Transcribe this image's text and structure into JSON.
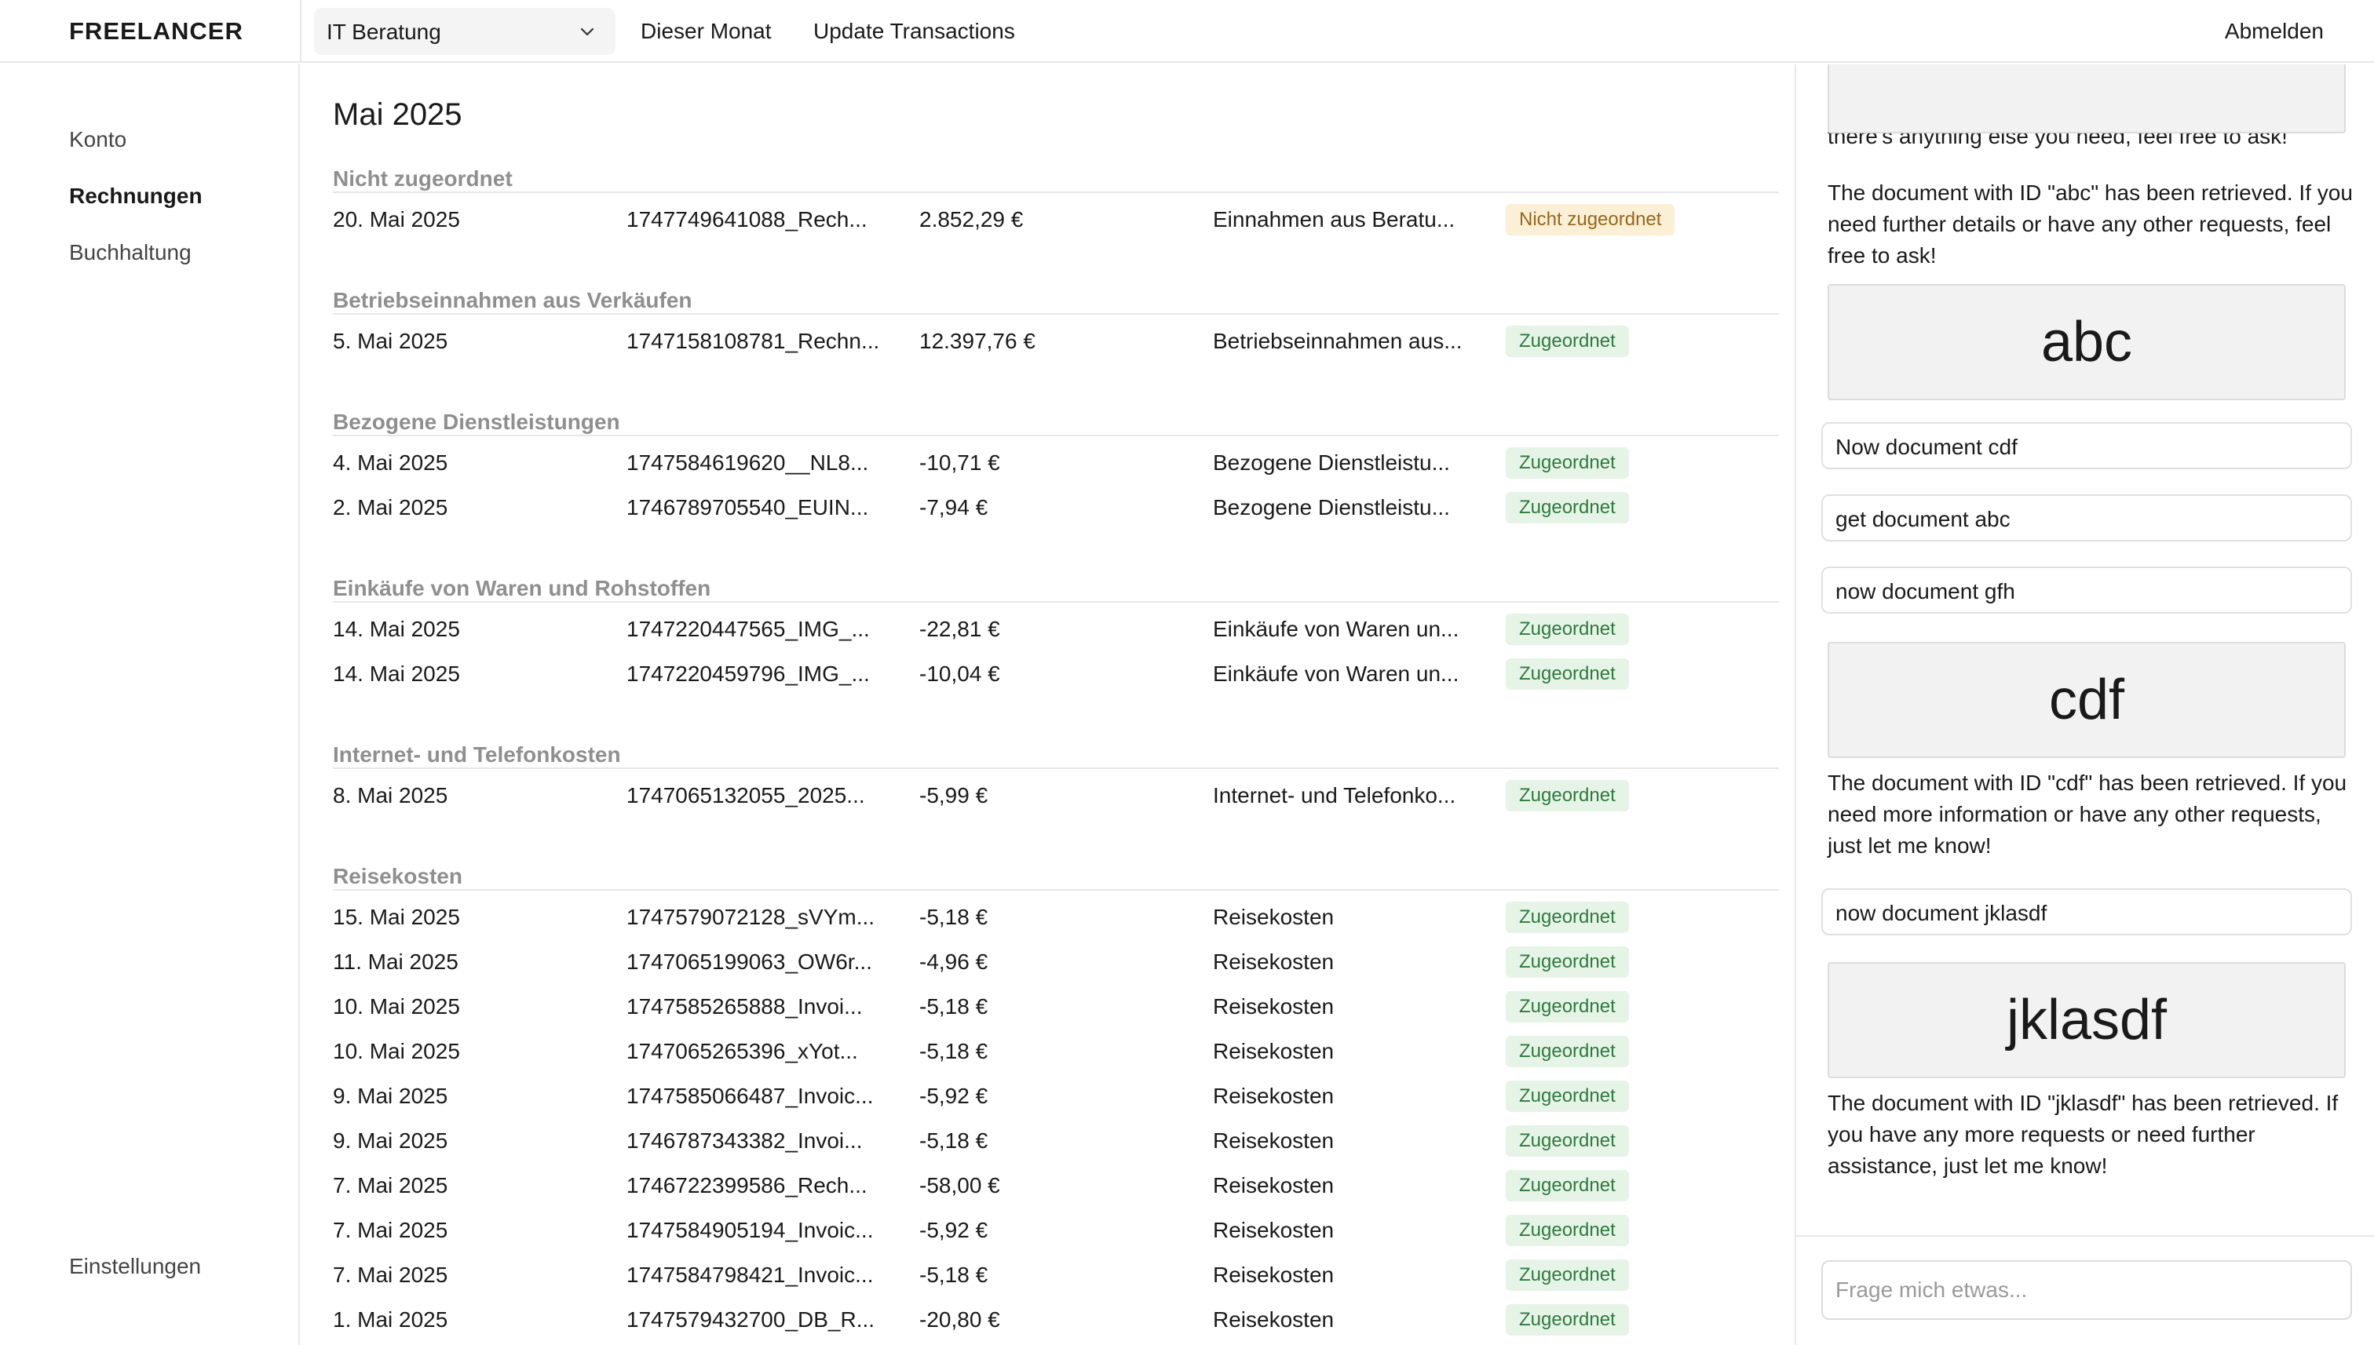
{
  "app": {
    "brand": "FREELANCER"
  },
  "header": {
    "company_select": "IT Beratung",
    "nav": [
      "Dieser Monat",
      "Update Transactions"
    ],
    "logout": "Abmelden"
  },
  "sidebar": {
    "items": [
      {
        "label": "Konto",
        "active": false
      },
      {
        "label": "Rechnungen",
        "active": true
      },
      {
        "label": "Buchhaltung",
        "active": false
      }
    ],
    "settings": "Einstellungen"
  },
  "main": {
    "month_title": "Mai 2025",
    "groups": [
      {
        "title": "Nicht zugeordnet",
        "rows": [
          {
            "date": "20. Mai 2025",
            "file": "1747749641088_Rech...",
            "amount": "2.852,29 €",
            "category": "Einnahmen aus Beratu...",
            "status": "Nicht zugeordnet",
            "status_type": "unassigned"
          }
        ]
      },
      {
        "title": "Betriebseinnahmen aus Verkäufen",
        "rows": [
          {
            "date": "5. Mai 2025",
            "file": "1747158108781_Rechn...",
            "amount": "12.397,76 €",
            "category": "Betriebseinnahmen aus...",
            "status": "Zugeordnet",
            "status_type": "assigned"
          }
        ]
      },
      {
        "title": "Bezogene Dienstleistungen",
        "rows": [
          {
            "date": "4. Mai 2025",
            "file": "1747584619620__NL8...",
            "amount": "-10,71 €",
            "category": "Bezogene Dienstleistu...",
            "status": "Zugeordnet",
            "status_type": "assigned"
          },
          {
            "date": "2. Mai 2025",
            "file": "1746789705540_EUIN...",
            "amount": "-7,94 €",
            "category": "Bezogene Dienstleistu...",
            "status": "Zugeordnet",
            "status_type": "assigned"
          }
        ]
      },
      {
        "title": "Einkäufe von Waren und Rohstoffen",
        "rows": [
          {
            "date": "14. Mai 2025",
            "file": "1747220447565_IMG_...",
            "amount": "-22,81 €",
            "category": "Einkäufe von Waren un...",
            "status": "Zugeordnet",
            "status_type": "assigned"
          },
          {
            "date": "14. Mai 2025",
            "file": "1747220459796_IMG_...",
            "amount": "-10,04 €",
            "category": "Einkäufe von Waren un...",
            "status": "Zugeordnet",
            "status_type": "assigned"
          }
        ]
      },
      {
        "title": "Internet- und Telefonkosten",
        "rows": [
          {
            "date": "8. Mai 2025",
            "file": "1747065132055_2025...",
            "amount": "-5,99 €",
            "category": "Internet- und Telefonko...",
            "status": "Zugeordnet",
            "status_type": "assigned"
          }
        ]
      },
      {
        "title": "Reisekosten",
        "rows": [
          {
            "date": "15. Mai 2025",
            "file": "1747579072128_sVYm...",
            "amount": "-5,18 €",
            "category": "Reisekosten",
            "status": "Zugeordnet",
            "status_type": "assigned"
          },
          {
            "date": "11. Mai 2025",
            "file": "1747065199063_OW6r...",
            "amount": "-4,96 €",
            "category": "Reisekosten",
            "status": "Zugeordnet",
            "status_type": "assigned"
          },
          {
            "date": "10. Mai 2025",
            "file": "1747585265888_Invoi...",
            "amount": "-5,18 €",
            "category": "Reisekosten",
            "status": "Zugeordnet",
            "status_type": "assigned"
          },
          {
            "date": "10. Mai 2025",
            "file": "1747065265396_xYot...",
            "amount": "-5,18 €",
            "category": "Reisekosten",
            "status": "Zugeordnet",
            "status_type": "assigned"
          },
          {
            "date": "9. Mai 2025",
            "file": "1747585066487_Invoic...",
            "amount": "-5,92 €",
            "category": "Reisekosten",
            "status": "Zugeordnet",
            "status_type": "assigned"
          },
          {
            "date": "9. Mai 2025",
            "file": "1746787343382_Invoi...",
            "amount": "-5,18 €",
            "category": "Reisekosten",
            "status": "Zugeordnet",
            "status_type": "assigned"
          },
          {
            "date": "7. Mai 2025",
            "file": "1746722399586_Rech...",
            "amount": "-58,00 €",
            "category": "Reisekosten",
            "status": "Zugeordnet",
            "status_type": "assigned"
          },
          {
            "date": "7. Mai 2025",
            "file": "1747584905194_Invoic...",
            "amount": "-5,92 €",
            "category": "Reisekosten",
            "status": "Zugeordnet",
            "status_type": "assigned"
          },
          {
            "date": "7. Mai 2025",
            "file": "1747584798421_Invoic...",
            "amount": "-5,18 €",
            "category": "Reisekosten",
            "status": "Zugeordnet",
            "status_type": "assigned"
          },
          {
            "date": "1. Mai 2025",
            "file": "1747579432700_DB_R...",
            "amount": "-20,80 €",
            "category": "Reisekosten",
            "status": "Zugeordnet",
            "status_type": "assigned"
          }
        ]
      }
    ]
  },
  "chat": {
    "messages": [
      {
        "type": "card",
        "text": ""
      },
      {
        "type": "assistant",
        "text": "The document with ID \"gfh\" has been retrieved. If there's anything else you need, feel free to ask!"
      },
      {
        "type": "assistant",
        "text": "The document with ID \"abc\" has been retrieved. If you need further details or have any other requests, feel free to ask!"
      },
      {
        "type": "card",
        "text": "abc"
      },
      {
        "type": "user",
        "text": "Now document cdf"
      },
      {
        "type": "user",
        "text": "get document abc"
      },
      {
        "type": "user",
        "text": "now document gfh"
      },
      {
        "type": "card",
        "text": "cdf"
      },
      {
        "type": "assistant",
        "text": "The document with ID \"cdf\" has been retrieved. If you need more information or have any other requests, just let me know!"
      },
      {
        "type": "user",
        "text": "now document jklasdf"
      },
      {
        "type": "card",
        "text": "jklasdf"
      },
      {
        "type": "assistant",
        "text": "The document with ID \"jklasdf\" has been retrieved. If you have any more requests or need further assistance, just let me know!"
      }
    ],
    "input_placeholder": "Frage mich etwas..."
  },
  "colors": {
    "assigned_bg": "#e6f4e8",
    "assigned_text": "#2f7a3d",
    "unassigned_bg": "#fbefd5",
    "unassigned_text": "#98661a",
    "group_header_text": "#8f8f8f"
  }
}
